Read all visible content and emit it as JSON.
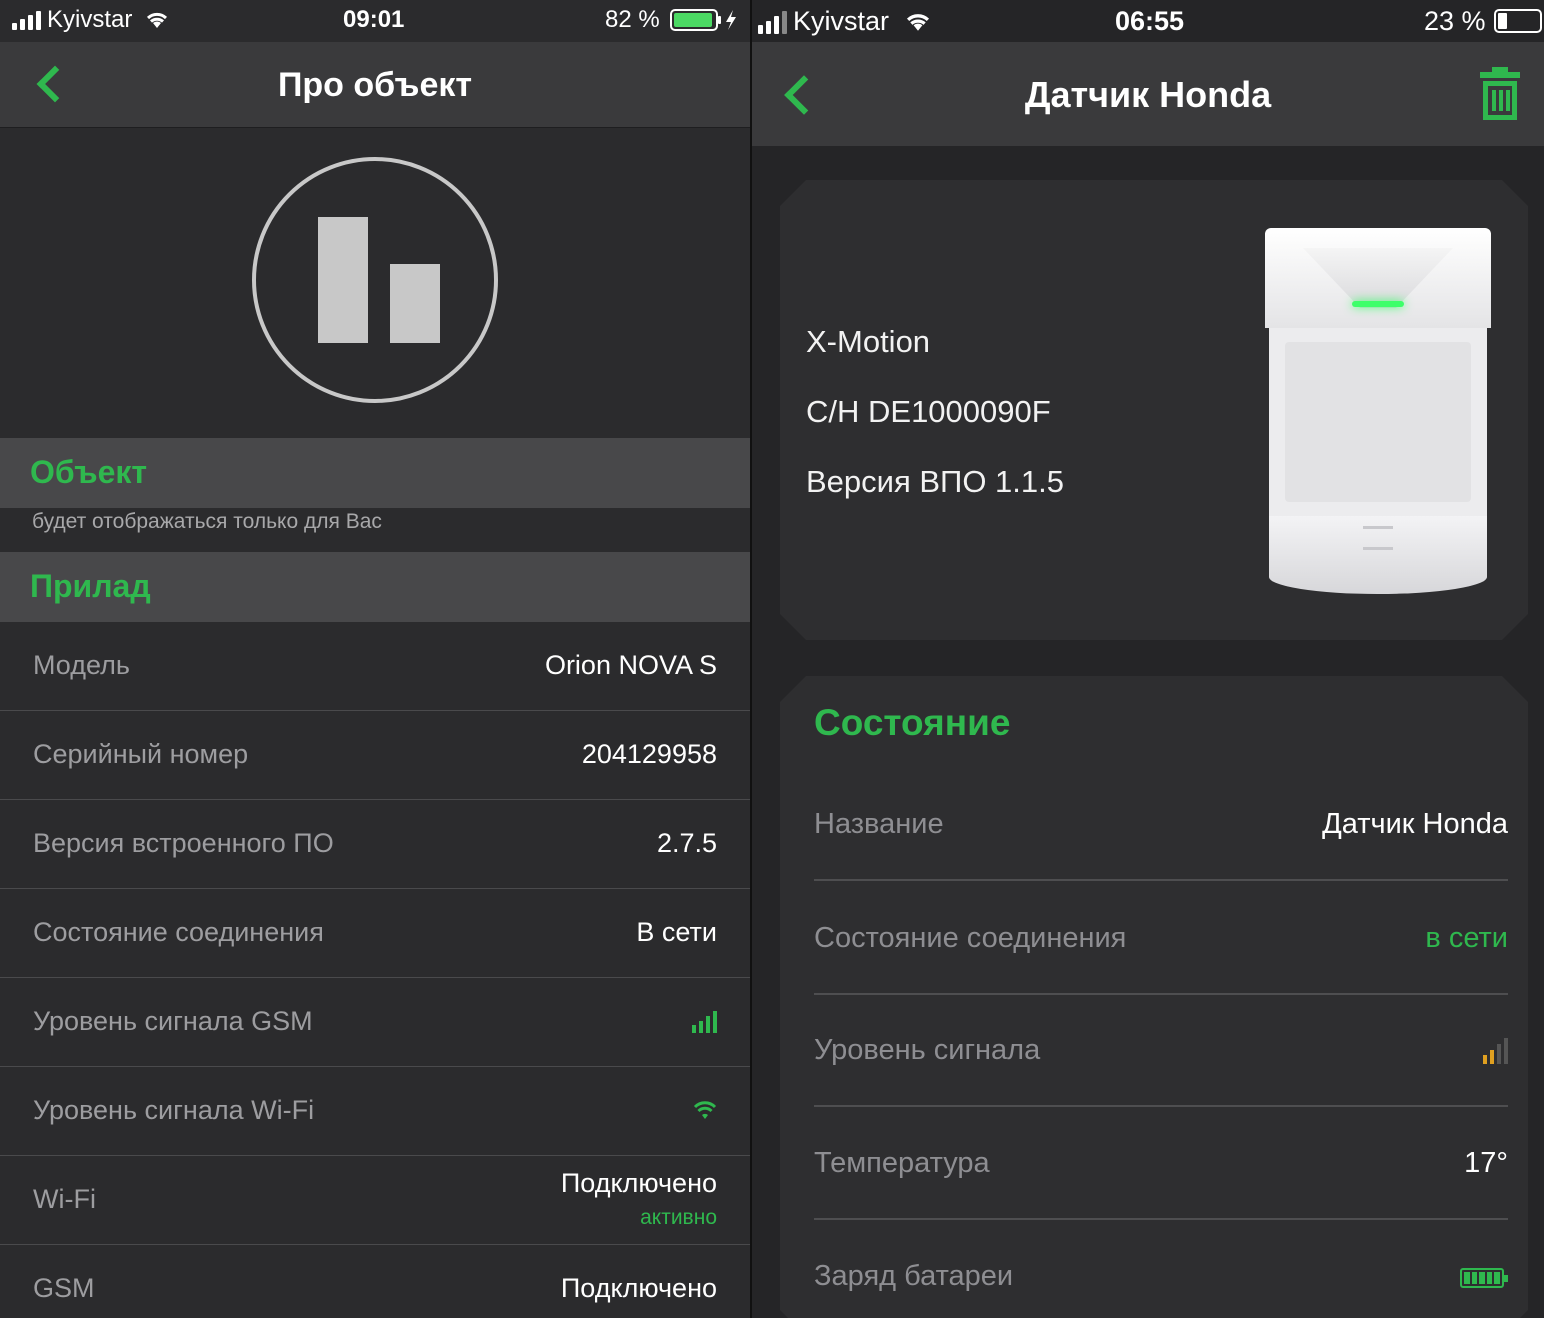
{
  "left": {
    "status": {
      "carrier": "Kyivstar",
      "time": "09:01",
      "battery": "82 %",
      "battery_level": 0.82
    },
    "nav": {
      "back_icon": "chevron-left-icon",
      "title": "Про объект"
    },
    "object_section": {
      "title": "Объект",
      "note": "будет отображаться только для Вас"
    },
    "device_section": {
      "title": "Прилад",
      "rows": [
        {
          "label": "Модель",
          "value": "Orion NOVA S"
        },
        {
          "label": "Серийный номер",
          "value": "204129958"
        },
        {
          "label": "Версия встроенного ПО",
          "value": "2.7.5"
        },
        {
          "label": "Состояние соединения",
          "value": "В сети"
        },
        {
          "label": "Уровень сигнала GSM",
          "icon": "signal-bars-icon"
        },
        {
          "label": "Уровень сигнала Wi-Fi",
          "icon": "wifi-icon"
        },
        {
          "label": "Wi-Fi",
          "value": "Подключено",
          "sub": "активно"
        },
        {
          "label": "GSM",
          "value": "Подключено"
        }
      ]
    }
  },
  "right": {
    "status": {
      "carrier": "Kyivstar",
      "time": "06:55",
      "battery": "23 %",
      "battery_level": 0.23
    },
    "nav": {
      "back_icon": "chevron-left-icon",
      "title": "Датчик  Honda",
      "delete_icon": "trash-icon"
    },
    "device": {
      "model": "X-Motion",
      "serial": "С/Н DE1000090F",
      "firmware": "Версия ВПО 1.1.5"
    },
    "state": {
      "title": "Состояние",
      "rows": [
        {
          "label": "Название",
          "value": "Датчик  Honda"
        },
        {
          "label": "Состояние соединения",
          "value": "в сети"
        },
        {
          "label": "Уровень сигнала",
          "icon": "signal-bars-icon",
          "signal_level": 2
        },
        {
          "label": "Температура",
          "value": "17°"
        },
        {
          "label": "Заряд батареи",
          "icon": "battery-icon",
          "battery_level": 1.0
        }
      ]
    }
  },
  "colors": {
    "accent": "#2fb84e",
    "warning": "#e0a020",
    "background": "#2b2b2d",
    "navbar": "#3a3a3c"
  }
}
